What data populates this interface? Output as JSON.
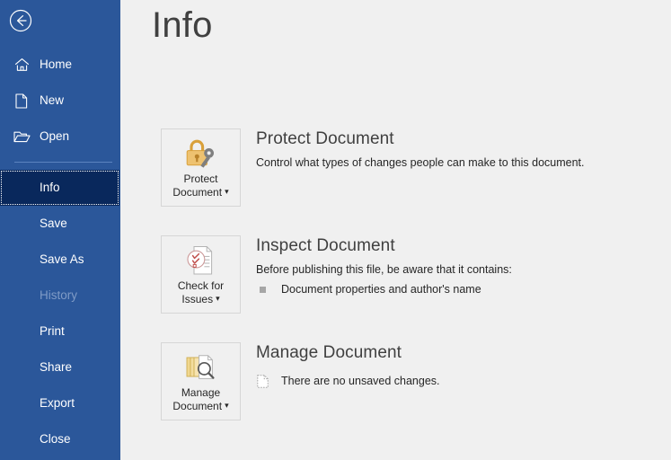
{
  "window": {
    "app": "Word",
    "background_color": "#f0f0f0"
  },
  "sidebar": {
    "background_color": "#2b579a",
    "selected_background_color": "#09285c",
    "back_button": {
      "name": "back-button",
      "icon": "back-arrow-icon",
      "label": "Back"
    },
    "items": [
      {
        "label": "Home",
        "icon": "home-icon",
        "state": "normal",
        "has_icon": true
      },
      {
        "label": "New",
        "icon": "new-icon",
        "state": "normal",
        "has_icon": true
      },
      {
        "label": "Open",
        "icon": "open-icon",
        "state": "normal",
        "has_icon": true
      },
      {
        "label": "Info",
        "icon": "",
        "state": "selected",
        "has_icon": false
      },
      {
        "label": "Save",
        "icon": "",
        "state": "normal",
        "has_icon": false
      },
      {
        "label": "Save As",
        "icon": "",
        "state": "normal",
        "has_icon": false
      },
      {
        "label": "History",
        "icon": "",
        "state": "disabled",
        "has_icon": false
      },
      {
        "label": "Print",
        "icon": "",
        "state": "normal",
        "has_icon": false
      },
      {
        "label": "Share",
        "icon": "",
        "state": "normal",
        "has_icon": false
      },
      {
        "label": "Export",
        "icon": "",
        "state": "normal",
        "has_icon": false
      },
      {
        "label": "Close",
        "icon": "",
        "state": "normal",
        "has_icon": false
      }
    ]
  },
  "main": {
    "title": "Info",
    "sections": [
      {
        "heading": "Protect Document",
        "description": "Control what types of changes people can make to this document.",
        "button": {
          "line1": "Protect",
          "line2": "Document",
          "icon": "lock-and-key-icon",
          "has_caret": true
        },
        "details": []
      },
      {
        "heading": "Inspect Document",
        "description": "Before publishing this file, be aware that it contains:",
        "button": {
          "line1": "Check for",
          "line2": "Issues",
          "icon": "document-inspect-icon",
          "has_caret": true
        },
        "details": [
          {
            "text": "Document properties and author's name",
            "icon": "square-bullet-icon"
          }
        ]
      },
      {
        "heading": "Manage Document",
        "description": "",
        "button": {
          "line1": "Manage",
          "line2": "Document",
          "icon": "document-versions-icon",
          "has_caret": true
        },
        "details": [
          {
            "text": "There are no unsaved changes.",
            "icon": "unsaved-document-icon"
          }
        ]
      }
    ]
  },
  "colors": {
    "accent_blue": "#2b579a",
    "selected_navy": "#09285c",
    "lock_gold": "#e8b44c",
    "key_gray": "#7f7f7f",
    "check_red": "#c0504d",
    "doc_tan": "#e8c96a",
    "text_dark": "#262626",
    "heading_gray": "#404040",
    "disabled_text": "#7f9bc6"
  }
}
